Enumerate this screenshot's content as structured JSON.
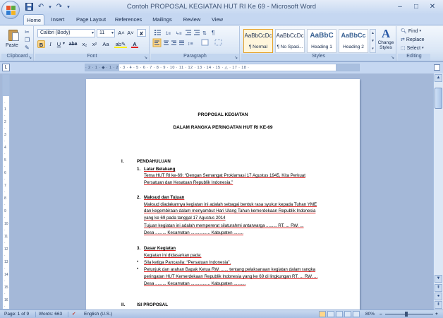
{
  "window": {
    "title": "Contoh PROPOSAL KEGIATAN HUT RI Ke 69 - Microsoft Word",
    "minimize": "–",
    "maximize": "□",
    "close": "✕"
  },
  "qat": {
    "save_icon": "save-icon",
    "undo": "↶",
    "undo_drop": "▾",
    "redo": "↷",
    "customize": "▾"
  },
  "tabs": [
    "Home",
    "Insert",
    "Page Layout",
    "References",
    "Mailings",
    "Review",
    "View"
  ],
  "ribbon": {
    "clipboard": {
      "label": "Clipboard",
      "paste": "Paste"
    },
    "font": {
      "label": "Font",
      "font_name": "Calibri (Body)",
      "font_size": "11",
      "grow": "A˄",
      "shrink": "A˅",
      "clear": "✘",
      "bold": "B",
      "italic": "I",
      "underline": "U",
      "strike": "abe",
      "subscript": "x₂",
      "superscript": "x²",
      "change_case": "Aa",
      "highlight": "ab✎",
      "font_color": "A"
    },
    "paragraph": {
      "label": "Paragraph"
    },
    "styles": {
      "label": "Styles",
      "items": [
        {
          "sample": "AaBbCcDc",
          "name": "¶ Normal"
        },
        {
          "sample": "AaBbCcDc",
          "name": "¶ No Spaci..."
        },
        {
          "sample": "AaBbC",
          "name": "Heading 1"
        },
        {
          "sample": "AaBbCc",
          "name": "Heading 2"
        }
      ],
      "change_styles": "Change Styles"
    },
    "editing": {
      "label": "Editing",
      "find": "Find",
      "replace": "Replace",
      "select": "Select"
    }
  },
  "ruler": {
    "numbers": "· 2 · 1 · ◆ · 1 · 2 · 3 · 4 · 5 · 6 · 7 · 8 · 9 · 10 · 11 · 12 · 13 · 14 · 15 · △ · 17 · 18 ·"
  },
  "document": {
    "title1": "PROPOSAL KEGIATAN",
    "title2": "DALAM RANGKA PERINGATAN HUT RI KE-69",
    "sec1_num": "I.",
    "sec1_title": "PENDAHULUAN",
    "s1_num": "1.",
    "s1_title": "Latar Belakang",
    "s1_l1": "Tema  HUT  RI  ke-69:  “Dengan  Semangat  Proklamasi  17  Agustus  1945,  Kita  Perkuat",
    "s1_l2": "Persatuan dan Kesatuan Republik Indonesia.”",
    "s2_num": "2.",
    "s2_title": "Maksud dan Tujuan",
    "s2_l1": "Maksud diadakannya kegiatan ini adalah sebagai bentuk rasa syukur kepada Tuhan YME",
    "s2_l2": "dan kegembiraan dalam menyambut Hari Ulang Tahun kemerdekaan Republik Indonesia",
    "s2_l3": "yang ke 69 pada tanggal 17 Agustus 2014",
    "s2_l4": "Tujuan  kegiatan  ini  adalah  mempererat  silaturahmi  antarwarga  .........  RT. ...  RW. ...",
    "s2_l5": "Desa ......... Kecamatan ................ Kabupaten ........",
    "s3_num": "3.",
    "s3_title": "Dasar Kegiatan",
    "s3_l1": "Kegiatan ini didasarkan pada:",
    "b1": "Sila ketiga Pancasila: “Persatuan Indonesia”.",
    "b2_l1": "Petunjuk dan arahan Bapak Ketua RW. ...... tentang pelaksanaan kegiatan dalam rangka",
    "b2_l2": "peringatan HUT Kemerdekaan Republik Indonesia yang ke 69 di lingkungan RT. ... RW. ...",
    "b2_l3": "Desa ......... Kecamatan ................ Kabupaten ..........",
    "bullet": "•",
    "sec2_num": "II.",
    "sec2_title": "ISI PROPOSAL"
  },
  "status": {
    "page": "Page: 1 of 9",
    "words": "Words: 663",
    "language": "English (U.S.)",
    "zoom": "80%",
    "zoom_minus": "–",
    "zoom_plus": "+"
  }
}
